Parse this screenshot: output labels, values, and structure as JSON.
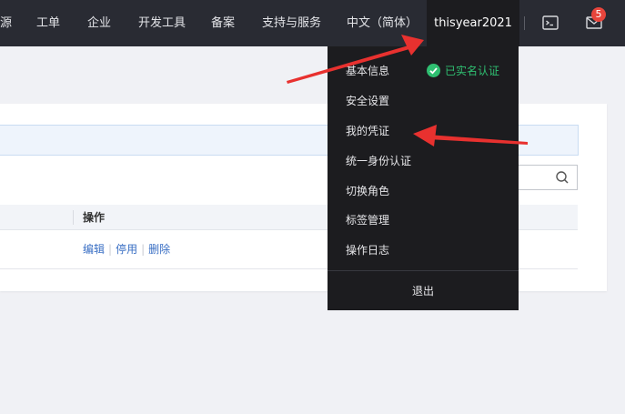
{
  "topnav": {
    "items": [
      {
        "label": "源"
      },
      {
        "label": "工单"
      },
      {
        "label": "企业"
      },
      {
        "label": "开发工具"
      },
      {
        "label": "备案"
      },
      {
        "label": "支持与服务"
      },
      {
        "label": "中文（简体）"
      }
    ],
    "username": "thisyear2021",
    "terminal_icon": "terminal-icon",
    "mail_icon": "mail-icon",
    "mail_badge": "5"
  },
  "user_menu": {
    "items": [
      {
        "label": "基本信息"
      },
      {
        "label": "安全设置"
      },
      {
        "label": "我的凭证"
      },
      {
        "label": "统一身份认证"
      },
      {
        "label": "切换角色"
      },
      {
        "label": "标签管理"
      },
      {
        "label": "操作日志"
      }
    ],
    "verified_label": "已实名认证",
    "verified_icon": "check-circle-icon",
    "logout_label": "退出"
  },
  "content": {
    "table_header_action": "操作",
    "row_actions": [
      "编辑",
      "停用",
      "删除"
    ],
    "search_icon": "search-icon"
  },
  "colors": {
    "topbar": "#292b33",
    "menu_bg": "#1c1c1f",
    "verified": "#2fbf71",
    "badge": "#e8453c",
    "link": "#3a6fc4",
    "arrow": "#e8312f"
  }
}
